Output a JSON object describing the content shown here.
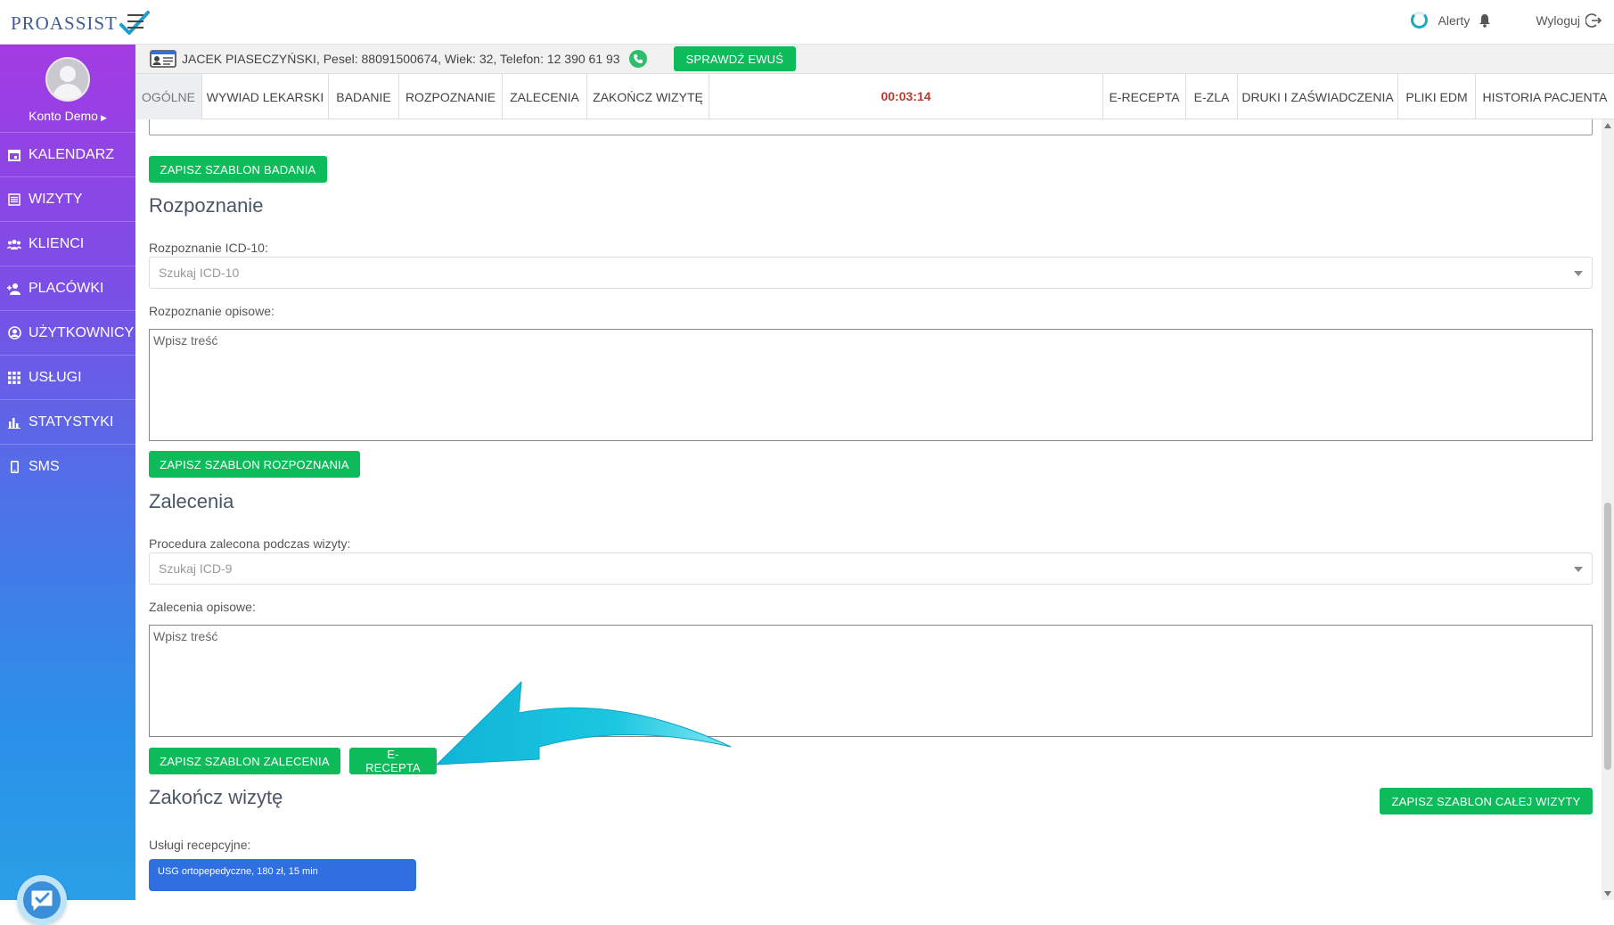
{
  "app": {
    "logo_text": "PROASSIST",
    "alerts_label": "Alerty",
    "logout_label": "Wyloguj"
  },
  "sidebar": {
    "profile_name": "Konto Demo",
    "items": [
      {
        "label": "KALENDARZ",
        "icon": "calendar-icon"
      },
      {
        "label": "WIZYTY",
        "icon": "list-icon"
      },
      {
        "label": "KLIENCI",
        "icon": "users-icon"
      },
      {
        "label": "PLACÓWKI",
        "icon": "user-add-icon"
      },
      {
        "label": "UŻYTKOWNICY",
        "icon": "user-circle-icon"
      },
      {
        "label": "USŁUGI",
        "icon": "grid-icon"
      },
      {
        "label": "STATYSTYKI",
        "icon": "bar-chart-icon"
      },
      {
        "label": "SMS",
        "icon": "phone-icon"
      }
    ]
  },
  "patient": {
    "info": "JACEK PIASECZYŃSKI, Pesel: 88091500674, Wiek: 32, Telefon: 12 390 61 93",
    "ewus_button": "SPRAWDŹ EWUŚ"
  },
  "tabs": {
    "left": [
      "OGÓLNE",
      "WYWIAD LEKARSKI",
      "BADANIE",
      "ROZPOZNANIE",
      "ZALECENIA",
      "ZAKOŃCZ WIZYTĘ"
    ],
    "timer": "00:03:14",
    "right": [
      "E-RECEPTA",
      "E-ZLA",
      "DRUKI I ZAŚWIADCZENIA",
      "PLIKI EDM",
      "HISTORIA PACJENTA"
    ]
  },
  "badanie": {
    "save_template_button": "ZAPISZ SZABLON BADANIA"
  },
  "rozpoznanie": {
    "title": "Rozpoznanie",
    "icd10_label": "Rozpoznanie ICD-10:",
    "icd10_placeholder": "Szukaj ICD-10",
    "desc_label": "Rozpoznanie opisowe:",
    "desc_placeholder": "Wpisz treść",
    "save_template_button": "ZAPISZ SZABLON ROZPOZNANIA"
  },
  "zalecenia": {
    "title": "Zalecenia",
    "procedure_label": "Procedura zalecona podczas wizyty:",
    "procedure_placeholder": "Szukaj ICD-9",
    "desc_label": "Zalecenia opisowe:",
    "desc_placeholder": "Wpisz treść",
    "save_template_button": "ZAPISZ SZABLON ZALECENIA",
    "erecepta_button": "E-RECEPTA"
  },
  "zakoncz": {
    "title": "Zakończ wizytę",
    "save_all_button": "ZAPISZ SZABLON CAŁEJ WIZYTY",
    "services_label": "Usługi recepcyjne:",
    "service_chip": "USG ortopepedyczne, 180 zł, 15 min"
  },
  "colors": {
    "accent_green": "#0dbb5b",
    "timer_red": "#c0392b",
    "chip_blue": "#2f6fe0",
    "arrow_cyan": "#1cc6e0"
  }
}
